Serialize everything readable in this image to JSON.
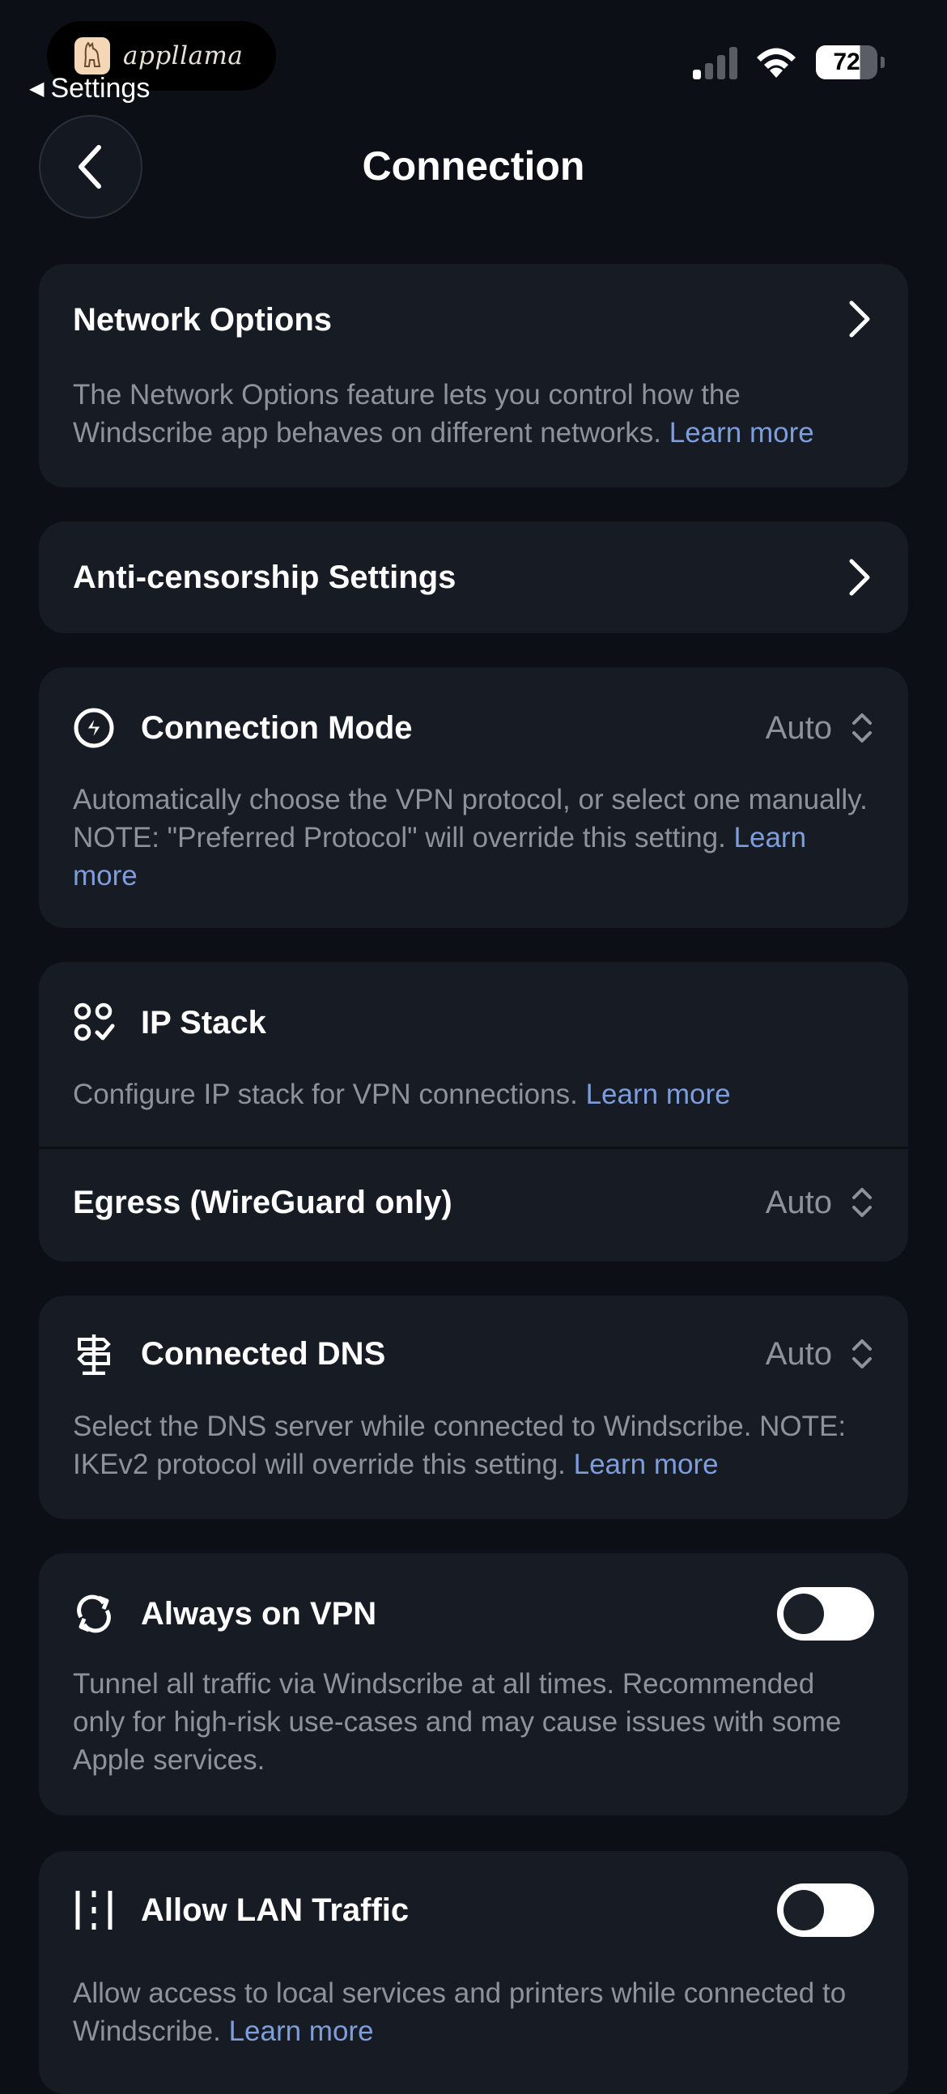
{
  "status_bar": {
    "app_badge": "appllama",
    "back_app_label": "Settings",
    "battery": "72"
  },
  "header": {
    "title": "Connection"
  },
  "network_options": {
    "title": "Network Options",
    "description": "The Network Options feature lets you control how the Windscribe app behaves on different networks.",
    "link": "Learn more"
  },
  "anti_censorship": {
    "title": "Anti-censorship Settings"
  },
  "connection_mode": {
    "title": "Connection Mode",
    "value": "Auto",
    "description": "Automatically choose the VPN protocol, or select one manually. NOTE: \"Preferred Protocol\" will override this setting.",
    "link": "Learn more",
    "icon": "lightning-bolt-icon"
  },
  "ip_stack": {
    "title": "IP Stack",
    "description": "Configure IP stack for VPN connections.",
    "link": "Learn more",
    "icon": "ip-stack-icon",
    "egress_title": "Egress (WireGuard only)",
    "egress_value": "Auto"
  },
  "connected_dns": {
    "title": "Connected DNS",
    "value": "Auto",
    "description": "Select the DNS server while connected to Windscribe. NOTE: IKEv2 protocol will override this setting.",
    "link": "Learn more",
    "icon": "signpost-icon"
  },
  "always_on_vpn": {
    "title": "Always on VPN",
    "description": "Tunnel all traffic via Windscribe at all times. Recommended only for high-risk use-cases and may cause issues with some Apple services.",
    "enabled": false,
    "icon": "refresh-icon"
  },
  "allow_lan": {
    "title": "Allow LAN Traffic",
    "description": "Allow access to local services and printers while connected to Windscribe.",
    "link": "Learn more",
    "enabled": false,
    "icon": "lan-icon"
  },
  "colors": {
    "background": "#0c0f16",
    "card": "#161b24",
    "link": "#7e9ddd",
    "muted_text": "#8d929b"
  }
}
